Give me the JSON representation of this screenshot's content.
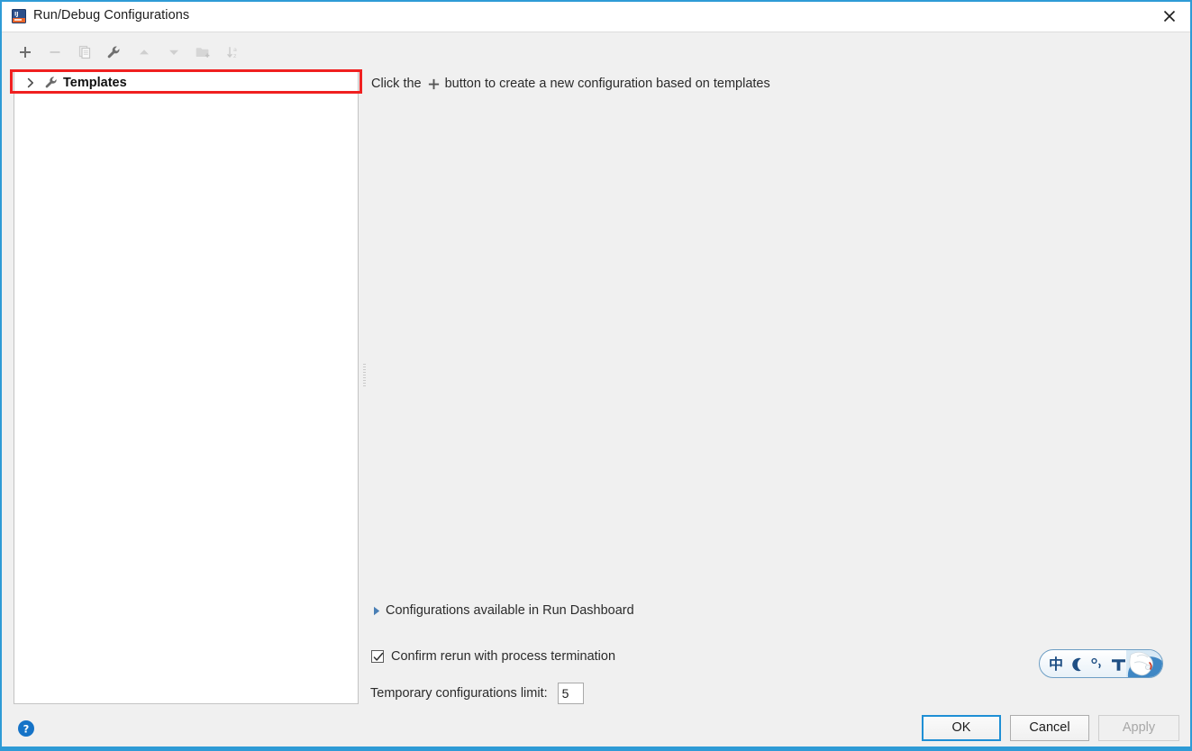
{
  "window": {
    "title": "Run/Debug Configurations",
    "app_icon": "intellij-idea-icon",
    "close_label": "Close",
    "accent_color": "#2e9bd6",
    "background_color": "#f0f0f0"
  },
  "toolbar": {
    "buttons": [
      {
        "name": "add-configuration-button",
        "icon": "plus-icon",
        "enabled": true,
        "tooltip": "Add New Configuration"
      },
      {
        "name": "remove-configuration-button",
        "icon": "minus-icon",
        "enabled": false,
        "tooltip": "Remove Configuration"
      },
      {
        "name": "copy-configuration-button",
        "icon": "copy-icon",
        "enabled": false,
        "tooltip": "Copy Configuration"
      },
      {
        "name": "edit-templates-button",
        "icon": "wrench-icon",
        "enabled": true,
        "tooltip": "Edit Templates"
      },
      {
        "name": "move-up-button",
        "icon": "arrow-up-icon",
        "enabled": false,
        "tooltip": "Move Up"
      },
      {
        "name": "move-down-button",
        "icon": "arrow-down-icon",
        "enabled": false,
        "tooltip": "Move Down"
      },
      {
        "name": "new-folder-button",
        "icon": "folder-add-icon",
        "enabled": false,
        "tooltip": "Create New Folder"
      },
      {
        "name": "sort-button",
        "icon": "sort-alphabetical-icon",
        "enabled": false,
        "tooltip": "Sort Configurations"
      }
    ]
  },
  "tree": {
    "items": [
      {
        "label": "Templates",
        "icon": "wrench-icon",
        "expanded": false,
        "selected": true,
        "highlighted": true
      }
    ]
  },
  "highlight": {
    "color": "#f02020"
  },
  "main": {
    "hint_prefix": "Click the",
    "hint_icon": "plus-icon",
    "hint_suffix": "button to create a new configuration based on templates"
  },
  "options": {
    "dashboard": {
      "label": "Configurations available in Run Dashboard",
      "icon": "triangle-right-icon",
      "expanded": false
    },
    "confirm_rerun": {
      "label": "Confirm rerun with process termination",
      "checked": true
    },
    "temp_limit": {
      "label": "Temporary configurations limit:",
      "value": "5"
    }
  },
  "ime": {
    "name": "chinese-ime-toolbar",
    "mode_label": "中",
    "items": [
      {
        "name": "ime-mode-chinese",
        "label": "中"
      },
      {
        "name": "ime-moon-icon",
        "label": ""
      },
      {
        "name": "ime-punctuation-icon",
        "label": "°,"
      },
      {
        "name": "ime-keyboard-icon",
        "label": ""
      },
      {
        "name": "ime-toolbox-icon",
        "label": ""
      }
    ]
  },
  "footer": {
    "help_label": "?",
    "ok_label": "OK",
    "cancel_label": "Cancel",
    "apply_label": "Apply",
    "apply_enabled": false
  }
}
